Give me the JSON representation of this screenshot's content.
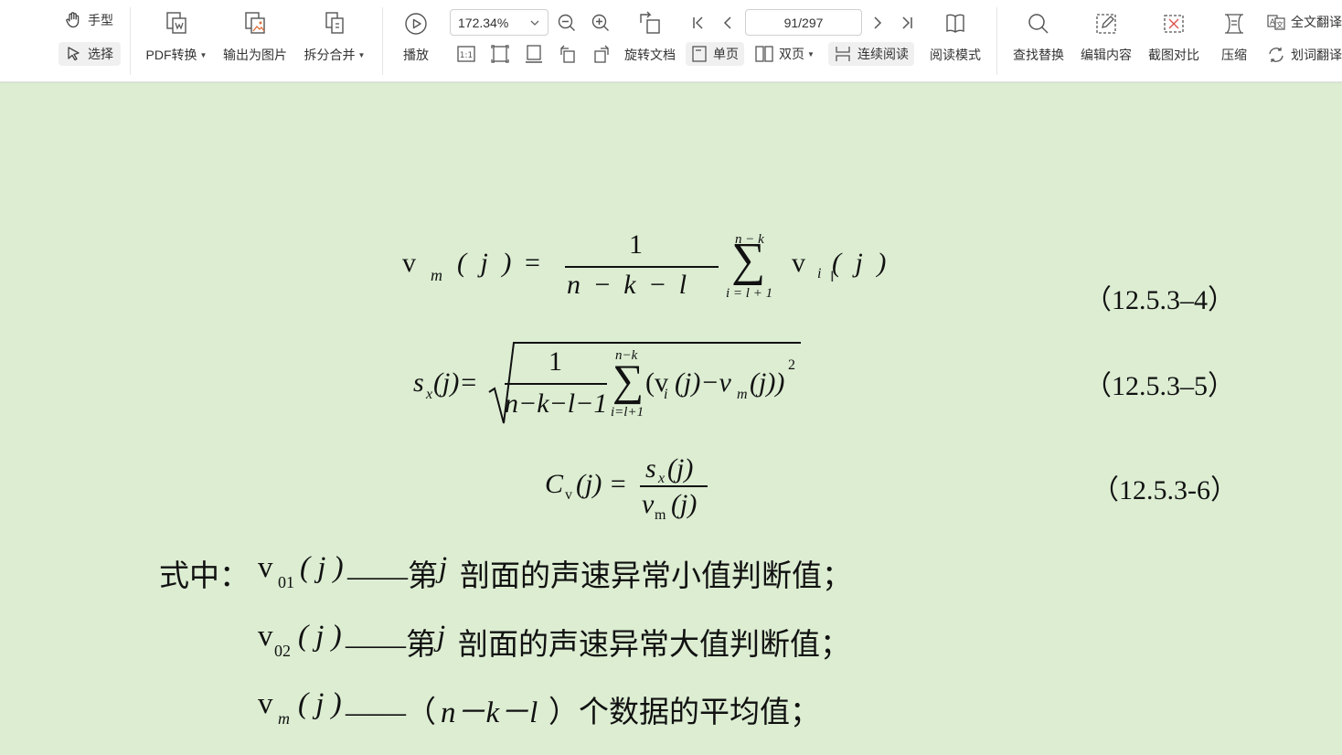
{
  "toolbar": {
    "hand": "手型",
    "select": "选择",
    "pdf_convert": "PDF转换",
    "export_image": "输出为图片",
    "split_merge": "拆分合并",
    "play": "播放",
    "zoom_value": "172.34%",
    "page_value": "91/297",
    "rotate_doc": "旋转文档",
    "single_page": "单页",
    "double_page": "双页",
    "continuous": "连续阅读",
    "read_mode": "阅读模式",
    "find_replace": "查找替换",
    "edit_content": "编辑内容",
    "screenshot_compare": "截图对比",
    "compress": "压缩",
    "full_translate": "全文翻译",
    "word_translate": "划词翻译"
  },
  "document": {
    "eq4": {
      "lhs_v": "v",
      "lhs_sub": "m",
      "lhs_arg": "( j )",
      "eq": "=",
      "num": "1",
      "den": "n − k − l",
      "sum_top": "n − k",
      "sum_bot": "i = l + 1",
      "term_v": "v",
      "term_sub": "i",
      "term_arg": "( j )",
      "number": "（12.5.3–4）"
    },
    "eq5": {
      "lhs_s": "s",
      "lhs_sub": "x",
      "lhs_arg": "(j)=",
      "num": "1",
      "den": "n−k−l−1",
      "sum_top": "n−k",
      "sum_bot": "i=l+1",
      "term_a": "(v",
      "term_a_sub": "i",
      "term_b": "(j)−v",
      "term_b_sub": "m",
      "term_c": "(j))",
      "power": "2",
      "number": "（12.5.3–5）"
    },
    "eq6": {
      "lhs_c": "C",
      "lhs_sub": "v",
      "lhs_arg": "(j) =",
      "num_s": "s",
      "num_sub": "x",
      "num_arg": "(j)",
      "den_v": "v",
      "den_sub": "m",
      "den_arg": "(j)",
      "number": "（12.5.3-6）"
    },
    "defs": {
      "intro": "式中：",
      "d1_v": "v",
      "d1_sub": "01",
      "d1_arg": "( j )",
      "d1_text": "——第",
      "d1_j": "j",
      "d1_rest": "剖面的声速异常小值判断值；",
      "d2_v": "v",
      "d2_sub": "02",
      "d2_arg": "( j )",
      "d2_text": "——第",
      "d2_j": "j",
      "d2_rest": "剖面的声速异常大值判断值；",
      "d3_v": "v",
      "d3_sub": "m",
      "d3_arg": "( j )",
      "d3_text": "——（",
      "d3_expr": "n－k－l",
      "d3_rest": "）个数据的平均值；"
    }
  }
}
